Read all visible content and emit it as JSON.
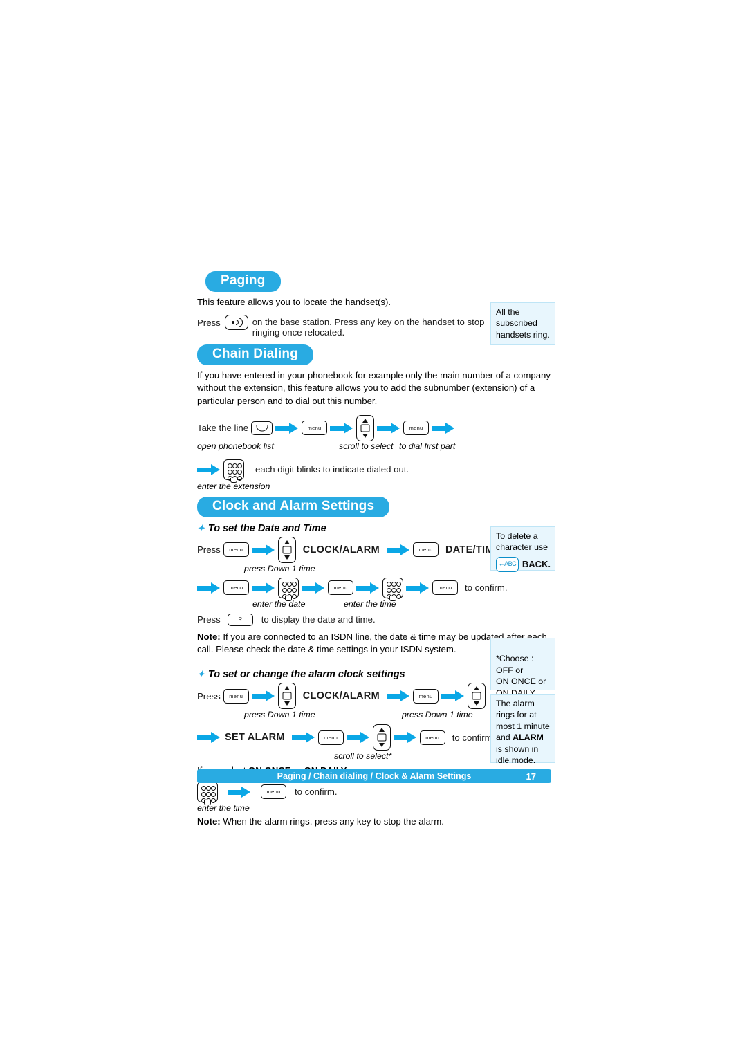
{
  "sections": {
    "paging": {
      "title": "Paging",
      "intro": "This feature allows you to locate the handset(s).",
      "press_label": "Press",
      "after_key": "on the base station. Press any key on the handset to stop ringing once relocated.",
      "note": "All the subscribed handsets ring."
    },
    "chain": {
      "title": "Chain Dialing",
      "intro": "If you have entered in your phonebook for example only the main number of a company without the extension, this feature allows you to add the subnumber (extension) of a particular person and to dial out this number.",
      "take_line": "Take the line",
      "cap_open": "open phonebook list",
      "cap_scroll": "scroll to select",
      "cap_dial": "to dial first part",
      "cap_extension": "enter the extension",
      "blink_text": "each digit blinks to indicate dialed out."
    },
    "clock": {
      "title": "Clock and Alarm Settings",
      "sub1": "To set the Date and Time",
      "sub2": "To set or change the alarm clock settings",
      "press_label": "Press",
      "clock_alarm": "CLOCK/ALARM",
      "date_time": "DATE/TIME",
      "set_alarm": "SET ALARM",
      "cap_press_down": "press Down 1 time",
      "cap_enter_date": "enter the date",
      "cap_enter_time": "enter the time",
      "cap_scroll_select": "scroll to select*",
      "to_confirm": "to confirm.",
      "display_date": "to display the date and time.",
      "note1_label": "Note:",
      "note1_text": "If you are connected to an ISDN line, the date & time may be updated after each call. Please check the date & time settings in your ISDN system.",
      "if_select_pre": "If you select",
      "if_select_a": "ON ONCE",
      "if_select_or": "or",
      "if_select_b": "ON DAILY",
      "if_select_post": ":",
      "note2_label": "Note:",
      "note2_text": "When the alarm rings, press any key to stop the alarm.",
      "note_delete": "To delete a character use",
      "back_label": "BACK.",
      "note_choose": "*Choose :\nOFF or\nON ONCE or\nON DAILY",
      "note_alarm_1": "The alarm rings for at most 1 minute and",
      "note_alarm_bold": "ALARM",
      "note_alarm_2": "is shown in idle mode."
    }
  },
  "keys": {
    "menu": "menu",
    "r": "R",
    "back": "BACK"
  },
  "footer": {
    "text": "Paging / Chain dialing / Clock & Alarm Settings",
    "page": "17"
  },
  "colors": {
    "accent": "#29abe2",
    "arrow": "#0aa7e6",
    "note_bg": "#e8f6fd"
  }
}
